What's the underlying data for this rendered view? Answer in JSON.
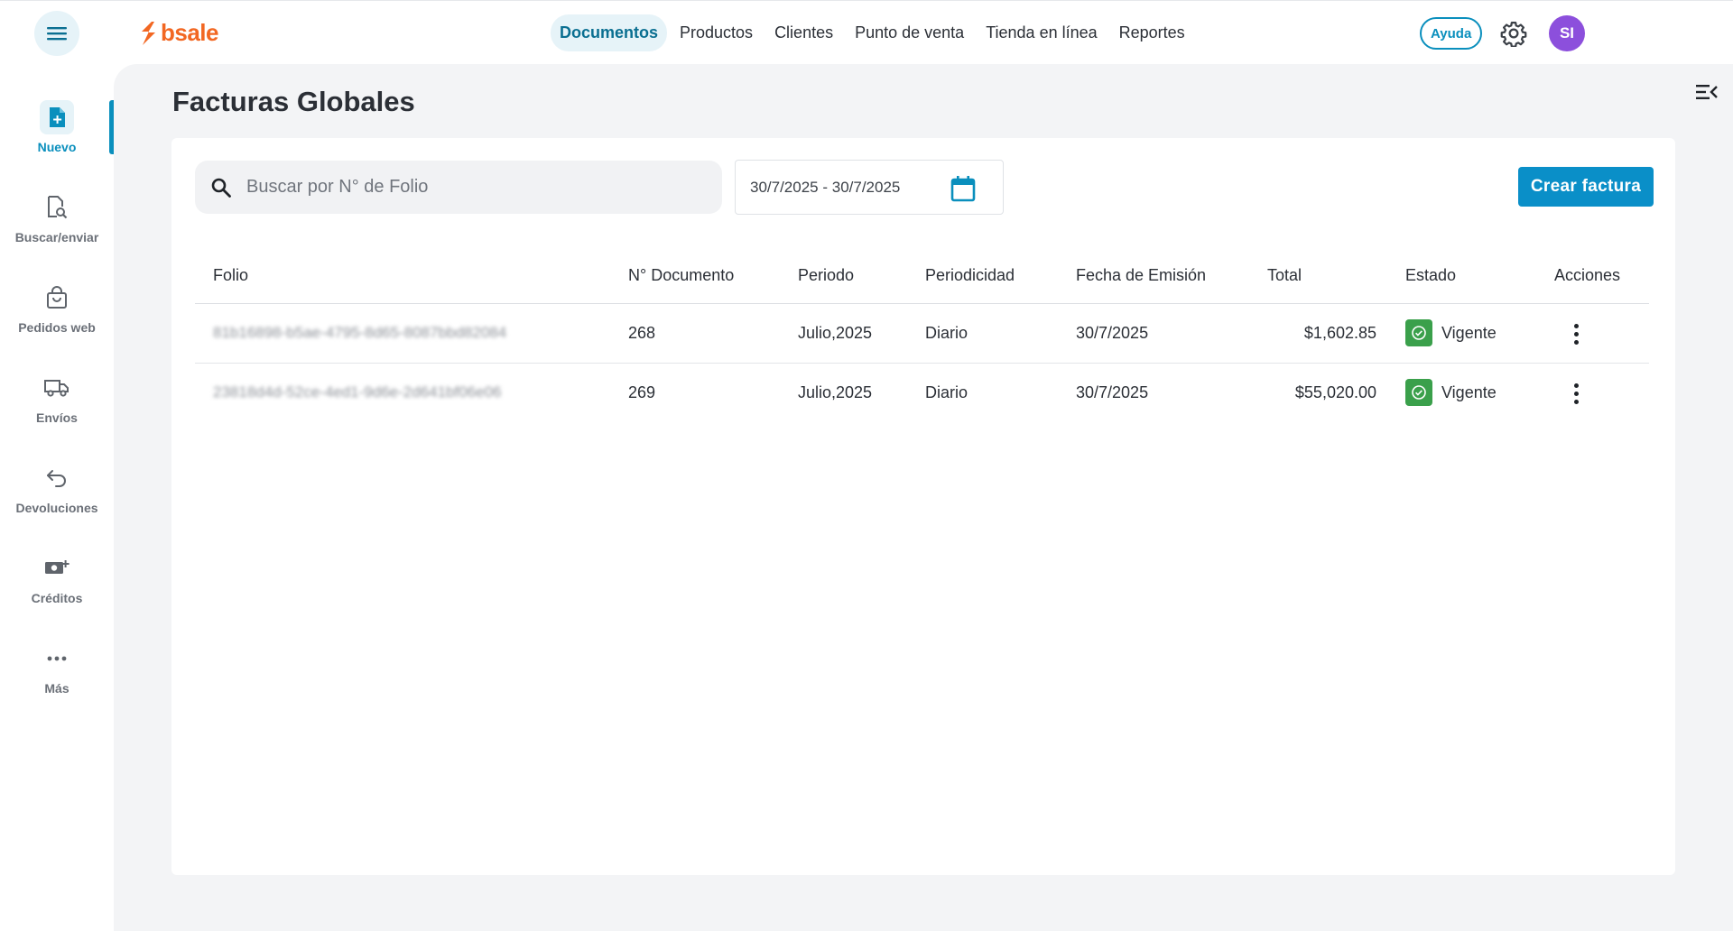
{
  "brand": {
    "name": "bsale",
    "color": "#f26722"
  },
  "accent": "#0a8fbd",
  "nav": {
    "items": [
      {
        "label": "Documentos",
        "active": true
      },
      {
        "label": "Productos"
      },
      {
        "label": "Clientes"
      },
      {
        "label": "Punto de venta"
      },
      {
        "label": "Tienda en línea"
      },
      {
        "label": "Reportes"
      }
    ]
  },
  "header": {
    "help_label": "Ayuda",
    "avatar_initials": "SI",
    "avatar_color": "#8c4fdc"
  },
  "sidebar": {
    "items": [
      {
        "label": "Nuevo",
        "icon": "new-document-icon",
        "active": true
      },
      {
        "label": "Buscar/enviar",
        "icon": "document-search-icon"
      },
      {
        "label": "Pedidos web",
        "icon": "shopping-bag-icon"
      },
      {
        "label": "Envíos",
        "icon": "truck-icon"
      },
      {
        "label": "Devoluciones",
        "icon": "return-arrow-icon"
      },
      {
        "label": "Créditos",
        "icon": "cash-plus-icon"
      },
      {
        "label": "Más",
        "icon": "more-dots-icon"
      }
    ]
  },
  "page": {
    "title": "Facturas Globales"
  },
  "filters": {
    "search_placeholder": "Buscar por N° de Folio",
    "date_range": "30/7/2025 - 30/7/2025",
    "create_label": "Crear factura"
  },
  "table": {
    "columns": [
      "Folio",
      "N° Documento",
      "Periodo",
      "Periodicidad",
      "Fecha de Emisión",
      "Total",
      "Estado",
      "Acciones"
    ],
    "rows": [
      {
        "folio": "81b16898-b5ae-4795-8d65-8087bbd82084",
        "doc": "268",
        "period": "Julio,2025",
        "periodicity": "Diario",
        "date": "30/7/2025",
        "total": "$1,602.85",
        "status": "Vigente"
      },
      {
        "folio": "23818d4d-52ce-4ed1-9d6e-2d641bf06e06",
        "doc": "269",
        "period": "Julio,2025",
        "periodicity": "Diario",
        "date": "30/7/2025",
        "total": "$55,020.00",
        "status": "Vigente"
      }
    ]
  },
  "status_color": "#3aa04b"
}
